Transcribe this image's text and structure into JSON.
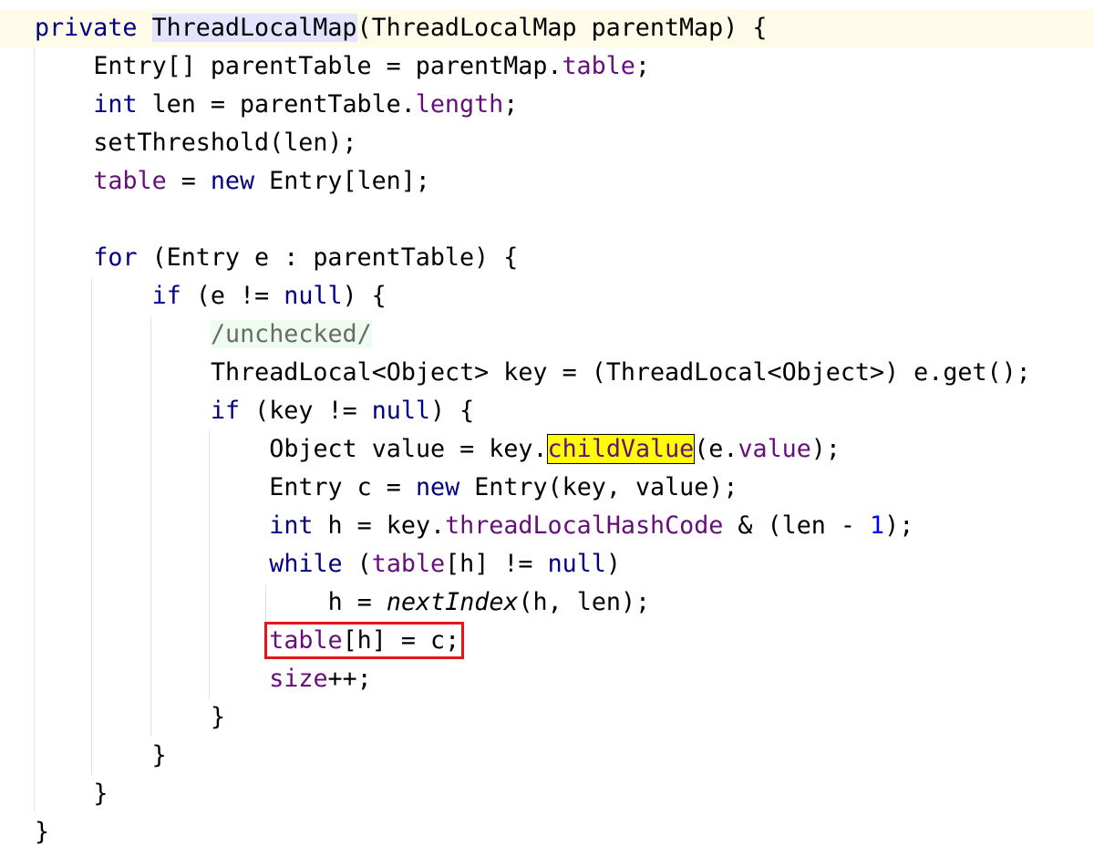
{
  "editor": {
    "language": "Java",
    "colors": {
      "keyword": "#000080",
      "field": "#660e7a",
      "number": "#0000ff",
      "search_highlight": "#ffff00",
      "annotation_box": "#e8141a",
      "caret_line": "#fefbe8"
    },
    "lines": [
      {
        "indent": 0,
        "tokens": [
          {
            "c": "kw",
            "t": "private"
          },
          {
            "t": " "
          },
          {
            "c": "decl",
            "t": "ThreadLocalMap"
          },
          {
            "t": "(ThreadLocalMap parentMap) {"
          }
        ]
      },
      {
        "indent": 1,
        "tokens": [
          {
            "t": "Entry[] parentTable = parentMap."
          },
          {
            "c": "field",
            "t": "table"
          },
          {
            "t": ";"
          }
        ]
      },
      {
        "indent": 1,
        "tokens": [
          {
            "c": "kw",
            "t": "int"
          },
          {
            "t": " len = parentTable."
          },
          {
            "c": "field",
            "t": "length"
          },
          {
            "t": ";"
          }
        ]
      },
      {
        "indent": 1,
        "tokens": [
          {
            "t": "setThreshold(len);"
          }
        ]
      },
      {
        "indent": 1,
        "tokens": [
          {
            "c": "field",
            "t": "table"
          },
          {
            "t": " = "
          },
          {
            "c": "kw",
            "t": "new"
          },
          {
            "t": " Entry[len];"
          }
        ]
      },
      {
        "indent": 0,
        "tokens": []
      },
      {
        "indent": 1,
        "tokens": [
          {
            "c": "kw",
            "t": "for"
          },
          {
            "t": " (Entry e : parentTable) {"
          }
        ]
      },
      {
        "indent": 2,
        "tokens": [
          {
            "c": "kw",
            "t": "if"
          },
          {
            "t": " (e != "
          },
          {
            "c": "kw",
            "t": "null"
          },
          {
            "t": ") {"
          }
        ]
      },
      {
        "indent": 3,
        "tokens": [
          {
            "c": "cm",
            "t": "/unchecked/"
          }
        ]
      },
      {
        "indent": 3,
        "tokens": [
          {
            "t": "ThreadLocal<Object> key = (ThreadLocal<Object>) e.get();"
          }
        ]
      },
      {
        "indent": 3,
        "tokens": [
          {
            "c": "kw",
            "t": "if"
          },
          {
            "t": " (key != "
          },
          {
            "c": "kw",
            "t": "null"
          },
          {
            "t": ") {"
          }
        ]
      },
      {
        "indent": 4,
        "tokens": [
          {
            "t": "Object value = key."
          },
          {
            "c": "hl field",
            "t": "childValue"
          },
          {
            "t": "(e."
          },
          {
            "c": "field",
            "t": "value"
          },
          {
            "t": ");"
          }
        ]
      },
      {
        "indent": 4,
        "tokens": [
          {
            "t": "Entry c = "
          },
          {
            "c": "kw",
            "t": "new"
          },
          {
            "t": " Entry(key, value);"
          }
        ]
      },
      {
        "indent": 4,
        "tokens": [
          {
            "c": "kw",
            "t": "int"
          },
          {
            "t": " h = key."
          },
          {
            "c": "field",
            "t": "threadLocalHashCode"
          },
          {
            "t": " & (len - "
          },
          {
            "c": "num",
            "t": "1"
          },
          {
            "t": ");"
          }
        ]
      },
      {
        "indent": 4,
        "tokens": [
          {
            "c": "kw",
            "t": "while"
          },
          {
            "t": " ("
          },
          {
            "c": "field",
            "t": "table"
          },
          {
            "t": "[h] != "
          },
          {
            "c": "kw",
            "t": "null"
          },
          {
            "t": ")"
          }
        ]
      },
      {
        "indent": 5,
        "tokens": [
          {
            "t": "h = "
          },
          {
            "c": "it",
            "t": "nextIndex"
          },
          {
            "t": "(h, len);"
          }
        ]
      },
      {
        "indent": 4,
        "box": true,
        "tokens": [
          {
            "c": "field",
            "t": "table"
          },
          {
            "t": "[h] = c;"
          }
        ]
      },
      {
        "indent": 4,
        "tokens": [
          {
            "c": "field",
            "t": "size"
          },
          {
            "t": "++;"
          }
        ]
      },
      {
        "indent": 3,
        "tokens": [
          {
            "t": "}"
          }
        ]
      },
      {
        "indent": 2,
        "tokens": [
          {
            "t": "}"
          }
        ]
      },
      {
        "indent": 1,
        "tokens": [
          {
            "t": "}"
          }
        ]
      },
      {
        "indent": 0,
        "tokens": [
          {
            "t": "}"
          }
        ]
      }
    ]
  }
}
